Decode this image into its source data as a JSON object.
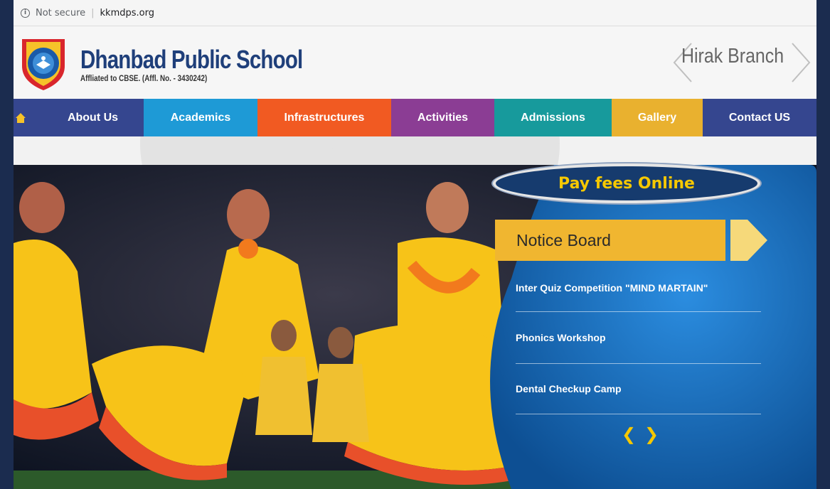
{
  "browser": {
    "security_label": "Not secure",
    "url": "kkmdps.org"
  },
  "header": {
    "school_name": "Dhanbad Public School",
    "affiliation": "Affliated to CBSE. (Affl. No. - 3430242)",
    "branch": "Hirak Branch"
  },
  "nav": {
    "items": [
      {
        "label": "About Us",
        "color": "#35468f"
      },
      {
        "label": "Academics",
        "color": "#1e9ad6"
      },
      {
        "label": "Infrastructures",
        "color": "#f15a22"
      },
      {
        "label": "Activities",
        "color": "#8b3d94"
      },
      {
        "label": "Admissions",
        "color": "#179a9c"
      },
      {
        "label": "Gallery",
        "color": "#e9b12f"
      },
      {
        "label": "Contact US",
        "color": "#35468f"
      }
    ]
  },
  "hero": {
    "pay_fees_label": "Pay fees Online"
  },
  "notice_board": {
    "title": "Notice Board",
    "items": [
      "Inter Quiz Competition \"MIND MARTAIN\"",
      "Phonics Workshop",
      "Dental Checkup Camp"
    ],
    "prev_label": "❮",
    "next_label": "❯"
  },
  "colors": {
    "brand_blue": "#1f3f7a",
    "notice_yellow": "#f0b630",
    "panel_blue": "#1669b8"
  }
}
